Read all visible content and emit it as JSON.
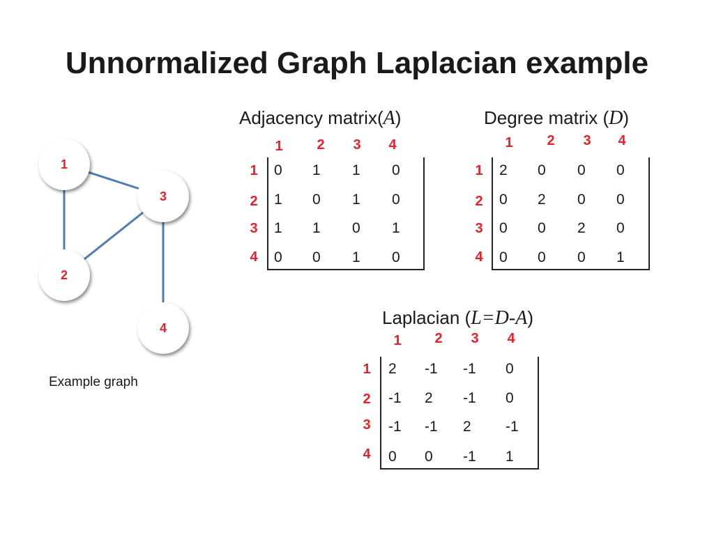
{
  "title": "Unnormalized Graph Laplacian example",
  "graph": {
    "caption": "Example graph",
    "nodes": [
      {
        "id": "1",
        "label": "1"
      },
      {
        "id": "2",
        "label": "2"
      },
      {
        "id": "3",
        "label": "3"
      },
      {
        "id": "4",
        "label": "4"
      }
    ],
    "edges": [
      [
        "1",
        "2"
      ],
      [
        "1",
        "3"
      ],
      [
        "2",
        "3"
      ],
      [
        "3",
        "4"
      ]
    ],
    "edge_color": "#4f7db2"
  },
  "adjacency": {
    "title_prefix": "Adjacency matrix(",
    "title_symbol": "A",
    "title_suffix": ")",
    "col_labels": [
      "1",
      "2",
      "3",
      "4"
    ],
    "row_labels": [
      "1",
      "2",
      "3",
      "4"
    ],
    "rows": [
      [
        "0",
        "1",
        "1",
        "0"
      ],
      [
        "1",
        "0",
        "1",
        "0"
      ],
      [
        "1",
        "1",
        "0",
        "1"
      ],
      [
        "0",
        "0",
        "1",
        "0"
      ]
    ]
  },
  "degree": {
    "title_prefix": "Degree matrix (",
    "title_symbol": "D",
    "title_suffix": ")",
    "col_labels": [
      "1",
      "2",
      "3",
      "4"
    ],
    "row_labels": [
      "1",
      "2",
      "3",
      "4"
    ],
    "rows": [
      [
        "2",
        "0",
        "0",
        "0"
      ],
      [
        "0",
        "2",
        "0",
        "0"
      ],
      [
        "0",
        "0",
        "2",
        "0"
      ],
      [
        "0",
        "0",
        "0",
        "1"
      ]
    ]
  },
  "laplacian": {
    "title_prefix": "Laplacian (",
    "title_symbol": "L=D-A",
    "title_suffix": ")",
    "col_labels": [
      "1",
      "2",
      "3",
      "4"
    ],
    "row_labels": [
      "1",
      "2",
      "3",
      "4"
    ],
    "rows": [
      [
        "2",
        "-1",
        "-1",
        "0"
      ],
      [
        "-1",
        "2",
        "-1",
        "0"
      ],
      [
        "-1",
        "-1",
        "2",
        "-1"
      ],
      [
        "0",
        "0",
        "-1",
        "1"
      ]
    ]
  },
  "colors": {
    "index_red": "#e8202a",
    "edge_blue": "#4f7db2"
  }
}
